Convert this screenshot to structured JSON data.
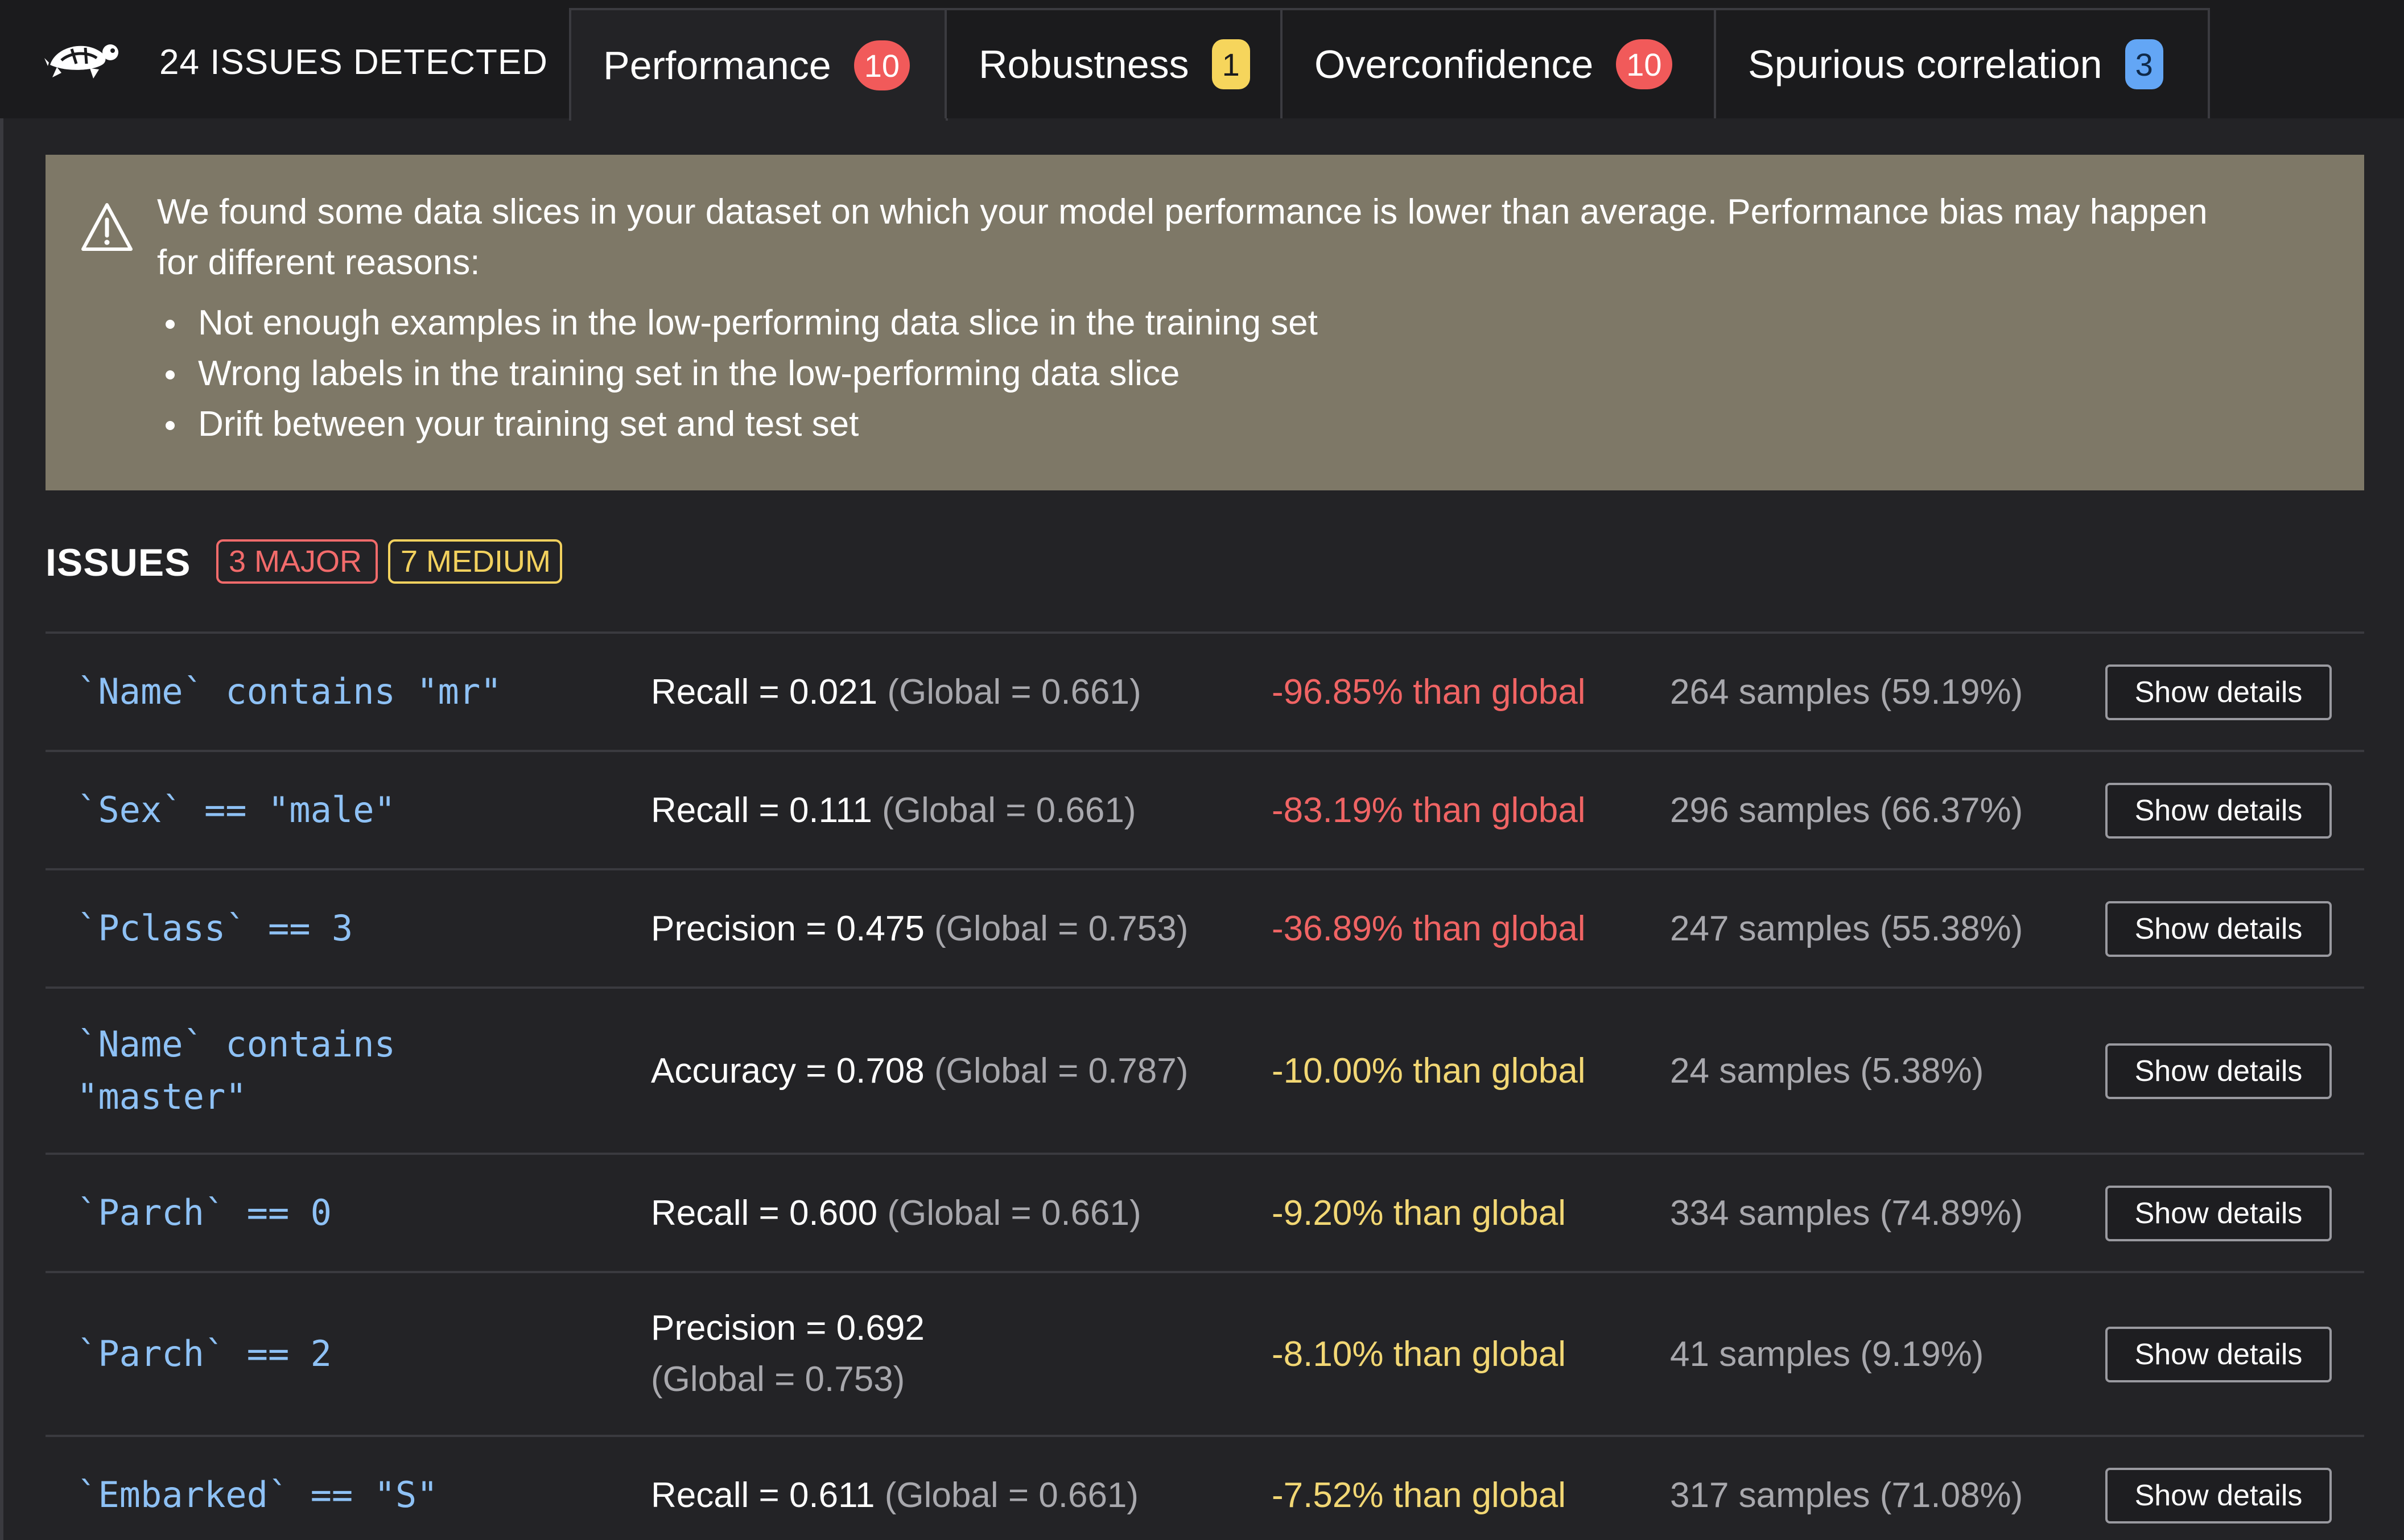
{
  "header": {
    "logo_icon": "turtle-logo-icon",
    "title": "24 ISSUES DETECTED",
    "tabs": [
      {
        "label": "Performance",
        "count": "10",
        "badge_color": "#f15a5a",
        "active": true
      },
      {
        "label": "Robustness",
        "count": "1",
        "badge_color": "#f6d55c",
        "active": false
      },
      {
        "label": "Overconfidence",
        "count": "10",
        "badge_color": "#f15a5a",
        "active": false
      },
      {
        "label": "Spurious correlation",
        "count": "3",
        "badge_color": "#63a6f5",
        "active": false
      }
    ]
  },
  "info": {
    "icon": "warning-icon",
    "line1": "We found some data slices in your dataset on which your model performance is lower than average. Performance bias may happen",
    "line2": "for different reasons:",
    "bullets": [
      "Not enough examples in the low-performing data slice in the training set",
      "Wrong labels in the training set in the low-performing data slice",
      "Drift between your training set and test set"
    ],
    "panel_color": "#7e7867"
  },
  "issues": {
    "heading": "ISSUES",
    "major_badge": "3 MAJOR",
    "medium_badge": "7 MEDIUM",
    "major_color": "#f26b6b",
    "medium_color": "#f2d15e",
    "details_label": "Show details",
    "rows": [
      {
        "slice": "`Name` contains \"mr\"",
        "metric": "Recall = 0.021",
        "global": "(Global = 0.661)",
        "delta": "-96.85% than global",
        "severity": "major",
        "samples": "264 samples (59.19%)"
      },
      {
        "slice": "`Sex` == \"male\"",
        "metric": "Recall = 0.111",
        "global": "(Global = 0.661)",
        "delta": "-83.19% than global",
        "severity": "major",
        "samples": "296 samples (66.37%)"
      },
      {
        "slice": "`Pclass` == 3",
        "metric": "Precision = 0.475",
        "global": "(Global = 0.753)",
        "delta": "-36.89% than global",
        "severity": "major",
        "samples": "247 samples (55.38%)"
      },
      {
        "slice_line1": "`Name` contains",
        "slice_line2": "\"master\"",
        "metric": "Accuracy = 0.708",
        "global": "(Global = 0.787)",
        "delta": "-10.00% than global",
        "severity": "medium",
        "samples": "24 samples (5.38%)"
      },
      {
        "slice": "`Parch` == 0",
        "metric": "Recall = 0.600",
        "global": "(Global = 0.661)",
        "delta": "-9.20% than global",
        "severity": "medium",
        "samples": "334 samples (74.89%)"
      },
      {
        "slice": "`Parch` == 2",
        "metric": "Precision = 0.692",
        "global": "(Global = 0.753)",
        "delta": "-8.10% than global",
        "severity": "medium",
        "samples": "41 samples (9.19%)"
      },
      {
        "slice": "`Embarked` == \"S\"",
        "metric": "Recall = 0.611",
        "global": "(Global = 0.661)",
        "delta": "-7.52% than global",
        "severity": "medium",
        "samples": "317 samples (71.08%)"
      }
    ]
  }
}
